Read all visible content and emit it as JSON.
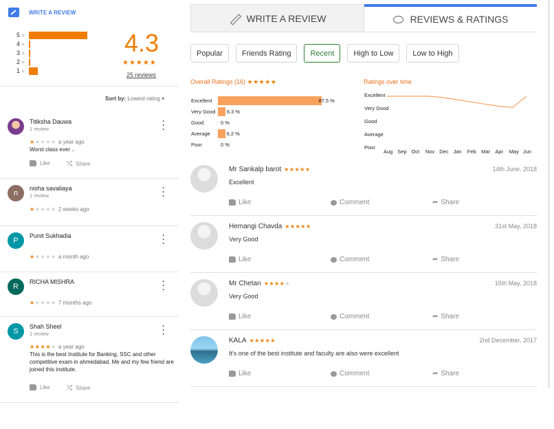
{
  "left": {
    "write_review_label": "WRITE A REVIEW",
    "summary": {
      "average": "4.3",
      "stars": "★★★★★",
      "count_label": "25 reviews",
      "distribution": [
        {
          "stars": "5",
          "value": 0.85
        },
        {
          "stars": "4",
          "value": 0.02
        },
        {
          "stars": "3",
          "value": 0.02
        },
        {
          "stars": "2",
          "value": 0.02
        },
        {
          "stars": "1",
          "value": 0.13
        }
      ]
    },
    "sort": {
      "prefix": "Sort by:",
      "value": "Lowest rating"
    },
    "reviews": [
      {
        "name": "Titiksha Dauwa",
        "sub": "1 review",
        "rating": 1,
        "time": "a year ago",
        "text": "Worst class ever ..",
        "like": "Like",
        "share": "Share",
        "avatar_letter": "",
        "avatar_color": "#b56ccf"
      },
      {
        "name": "nisha savaliaya",
        "sub": "1 review",
        "rating": 1,
        "time": "2 weeks ago",
        "text": "",
        "like": "",
        "share": "",
        "avatar_letter": "n",
        "avatar_color": "#8d6e63"
      },
      {
        "name": "Punit Sukhadia",
        "sub": "",
        "rating": 1,
        "time": "a month ago",
        "text": "",
        "like": "",
        "share": "",
        "avatar_letter": "P",
        "avatar_color": "#0097a7"
      },
      {
        "name": "RICHA MISHRA",
        "sub": "",
        "rating": 1,
        "time": "7 months ago",
        "text": "",
        "like": "",
        "share": "",
        "avatar_letter": "R",
        "avatar_color": "#00695c"
      },
      {
        "name": "Shah Sheel",
        "sub": "1 review",
        "rating": 4,
        "time": "a year ago",
        "text": "This is the best Institute for Banking, SSC and other competitive exam in ahmedabad. Me and my few friend are joined this institute.",
        "like": "Like",
        "share": "Share",
        "avatar_letter": "S",
        "avatar_color": "#0097a7"
      }
    ]
  },
  "right": {
    "tabs": [
      {
        "label": "WRITE A REVIEW"
      },
      {
        "label": "REVIEWS & RATINGS"
      }
    ],
    "filters": [
      "Popular",
      "Friends Rating",
      "Recent",
      "High to Low",
      "Low to High"
    ],
    "active_filter": "Recent",
    "overall": {
      "title": "Overall Ratings (16)",
      "stars": "★★★★★"
    },
    "over_time": {
      "title": "Ratings over time"
    },
    "reviews": [
      {
        "name": "Mr Sankalp barot",
        "stars": 5,
        "date": "14th June, 2018",
        "text": "Excellent"
      },
      {
        "name": "Hemangi Chavda",
        "stars": 4.5,
        "date": "31st May, 2018",
        "text": "Very Good"
      },
      {
        "name": "Mr Chetan",
        "stars": 4,
        "date": "15th May, 2018",
        "text": "Very Good"
      },
      {
        "name": "KALA",
        "stars": 5,
        "date": "2nd December, 2017",
        "text": "It's one of the best institute and faculty are also were excellent"
      }
    ],
    "actions": {
      "like": "Like",
      "comment": "Comment",
      "share": "Share"
    }
  },
  "chart_data": [
    {
      "type": "bar",
      "title": "Overall Ratings (16)",
      "categories": [
        "Excellent",
        "Very Good",
        "Good",
        "Average",
        "Poor"
      ],
      "values": [
        87.5,
        6.3,
        0,
        6.2,
        0
      ],
      "value_labels": [
        "87.5 %",
        "6.3 %",
        "0 %",
        "6.2 %",
        "0 %"
      ],
      "xlim": [
        0,
        100
      ],
      "orientation": "horizontal"
    },
    {
      "type": "line",
      "title": "Ratings over time",
      "categories": [
        "Aug",
        "Sep",
        "Oct",
        "Nov",
        "Dec",
        "Jan",
        "Feb",
        "Mar",
        "Apr",
        "May",
        "Jun"
      ],
      "y_categories": [
        "Excellent",
        "Very Good",
        "Good",
        "Average",
        "Poor"
      ],
      "values": [
        5,
        5,
        5,
        5,
        4.97,
        4.92,
        4.87,
        4.82,
        4.77,
        4.74,
        5
      ],
      "grid": false
    }
  ]
}
